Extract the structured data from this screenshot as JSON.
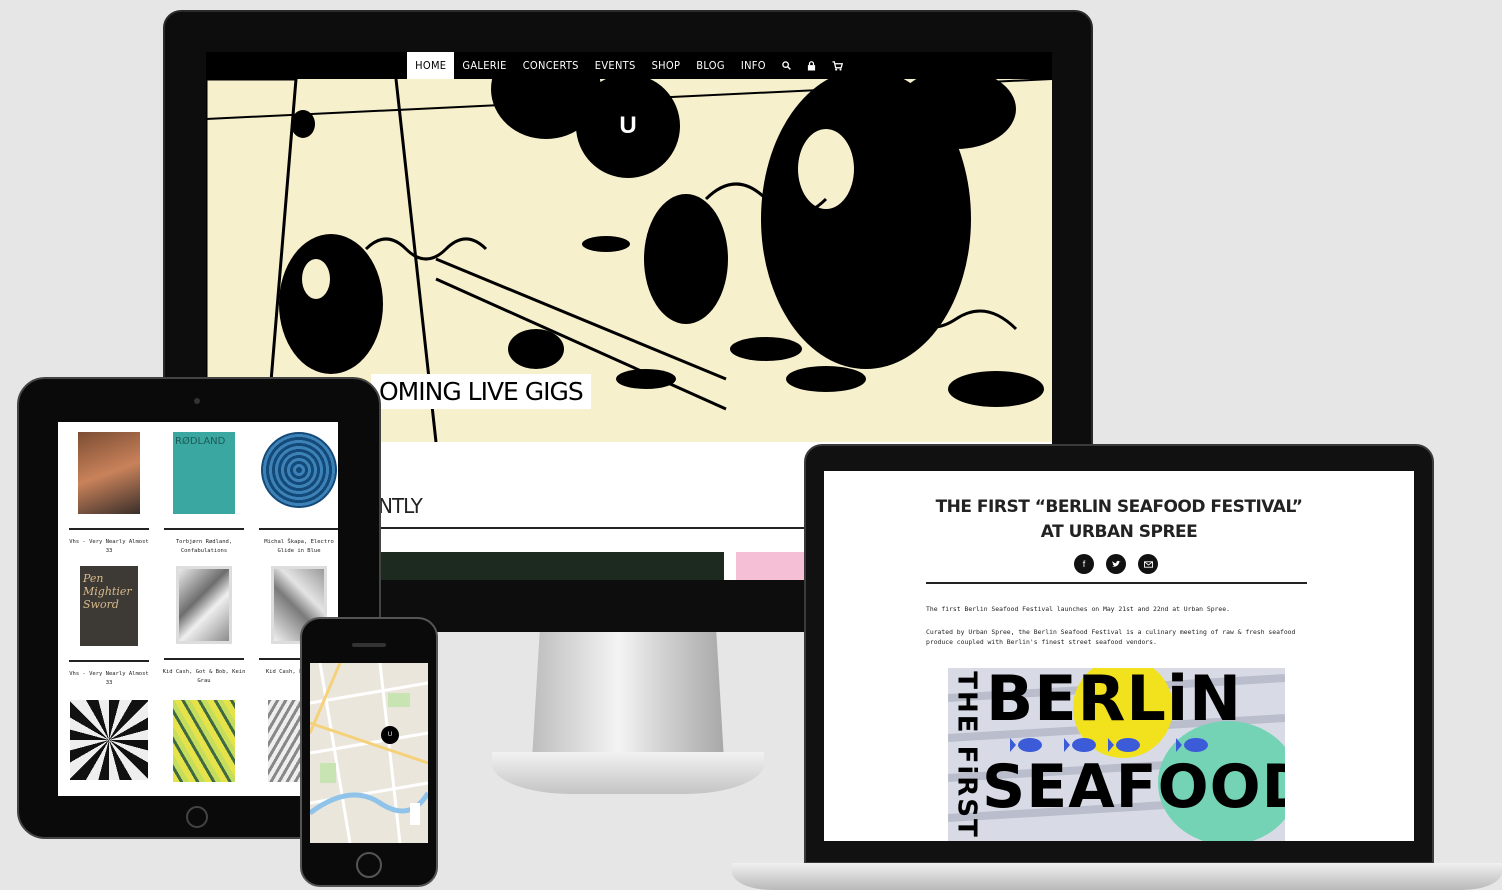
{
  "imac": {
    "nav": {
      "items": [
        "HOME",
        "GALERIE",
        "CONCERTS",
        "EVENTS",
        "SHOP",
        "BLOG",
        "INFO"
      ],
      "icons": [
        "search-icon",
        "lock-icon",
        "cart-icon"
      ]
    },
    "logo_letter": "U",
    "section_gigs": "OMING LIVE GIGS",
    "section_recent": "NTLY"
  },
  "ipad": {
    "captions": [
      "Vhs - Very Nearly Almost 33",
      "Torbjørn Rødland, Confabulations",
      "Michal Škapa, Electro Glide in Blue",
      "Vhs - Very Nearly Almost 33",
      "Kid Cash, Got & Bob, Kein Grau",
      "Kid Cash, Fle, Stein"
    ],
    "art_texts": [
      "",
      "RØDLAND",
      "",
      "Pen Mightier Sword",
      "",
      ""
    ]
  },
  "iphone": {
    "map_pin": "U"
  },
  "macbook": {
    "post_title": "THE FIRST “BERLIN SEAFOOD FESTIVAL” AT URBAN SPREE",
    "share_icons": [
      "facebook-icon",
      "twitter-icon",
      "mail-icon"
    ],
    "paragraph_1": "The first Berlin Seafood Festival launches on May 21st and 22nd at Urban Spree.",
    "paragraph_2": "Curated by Urban Spree, the Berlin Seafood Festival is a culinary meeting of raw & fresh seafood produce coupled with Berlin's finest street seafood vendors.",
    "poster": {
      "side_text": "THE FiRST",
      "line1": "BERLiN",
      "line2": "SEAFOOD"
    }
  },
  "colors": {
    "hero_cream": "#f6f0cd",
    "poster_yellow": "#f2e21d",
    "poster_mint": "#74d3b4",
    "poster_blue": "#3b5bd9"
  }
}
